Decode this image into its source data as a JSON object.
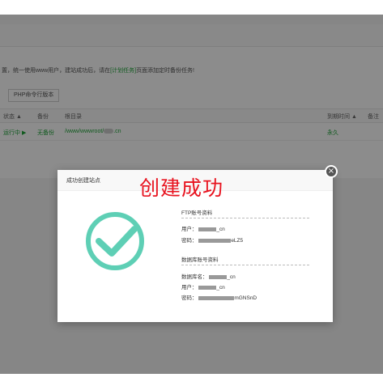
{
  "page": {
    "notice_prefix": "置，统一使用www用户，建站成功后，请在",
    "notice_link": "[计划任务]",
    "notice_suffix": "页面添加定时备份任务!",
    "php_button": "PHP命令行版本"
  },
  "table": {
    "headers": [
      "状态",
      "备份",
      "根目录",
      "到期时间",
      "备注"
    ],
    "row": {
      "status": "运行中 ▶",
      "backup": "无备份",
      "root": "/www/wwwroot/",
      "root_suffix": ".cn",
      "expiry": "永久"
    }
  },
  "annotation": "创建成功",
  "modal": {
    "title": "成功创建站点",
    "close": "×",
    "ftp_section": "FTP账号资料",
    "ftp_user_label": "用户：",
    "ftp_user_value": "_cn",
    "ftp_pass_label": "密码：",
    "ftp_pass_value": "eLZ5",
    "db_section": "数据库账号资料",
    "db_name_label": "数据库名：",
    "db_name_value": "_cn",
    "db_user_label": "用户：",
    "db_user_value": "_cn",
    "db_pass_label": "密码：",
    "db_pass_value": "mGNSnD"
  },
  "icon": {
    "check": "checkmark-circle-icon",
    "color": "#5ecfb5"
  }
}
